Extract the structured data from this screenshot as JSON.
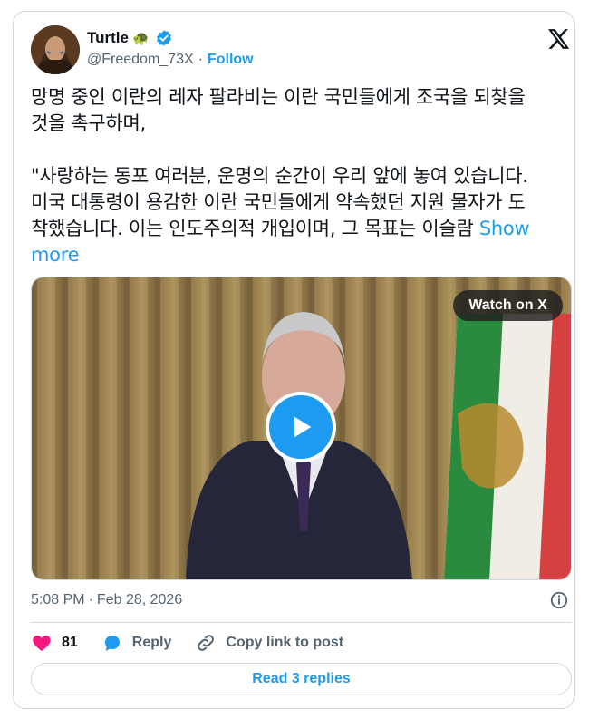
{
  "author": {
    "name": "Turtle",
    "emoji": "🐢",
    "handle": "@Freedom_73X",
    "separator": "·",
    "follow_label": "Follow"
  },
  "tweet": {
    "line1": "망명 중인 이란의 레자 팔라비는 이란 국민들에게 조국을 되찾을",
    "line2": "것을 촉구하며,",
    "quote_line1": "\"사랑하는 동포 여러분, 운명의 순간이 우리 앞에 놓여 있습니다.",
    "quote_line2": "미국 대통령이 용감한 이란 국민들에게 약속했던 지원 물자가 도",
    "quote_line3": "착했습니다. 이는 인도주의적 개입이며, 그 목표는 이슬람",
    "show_more": "Show more"
  },
  "media": {
    "watch_label": "Watch on X"
  },
  "meta": {
    "time": "5:08 PM",
    "separator": "·",
    "date": "Feb 28, 2026"
  },
  "actions": {
    "likes": "81",
    "reply_label": "Reply",
    "copy_label": "Copy link to post"
  },
  "read_replies_label": "Read 3 replies",
  "colors": {
    "accent": "#1d9bf0",
    "like": "#f91880",
    "text": "#0f1419",
    "muted": "#536471",
    "border": "#cfd9de"
  }
}
